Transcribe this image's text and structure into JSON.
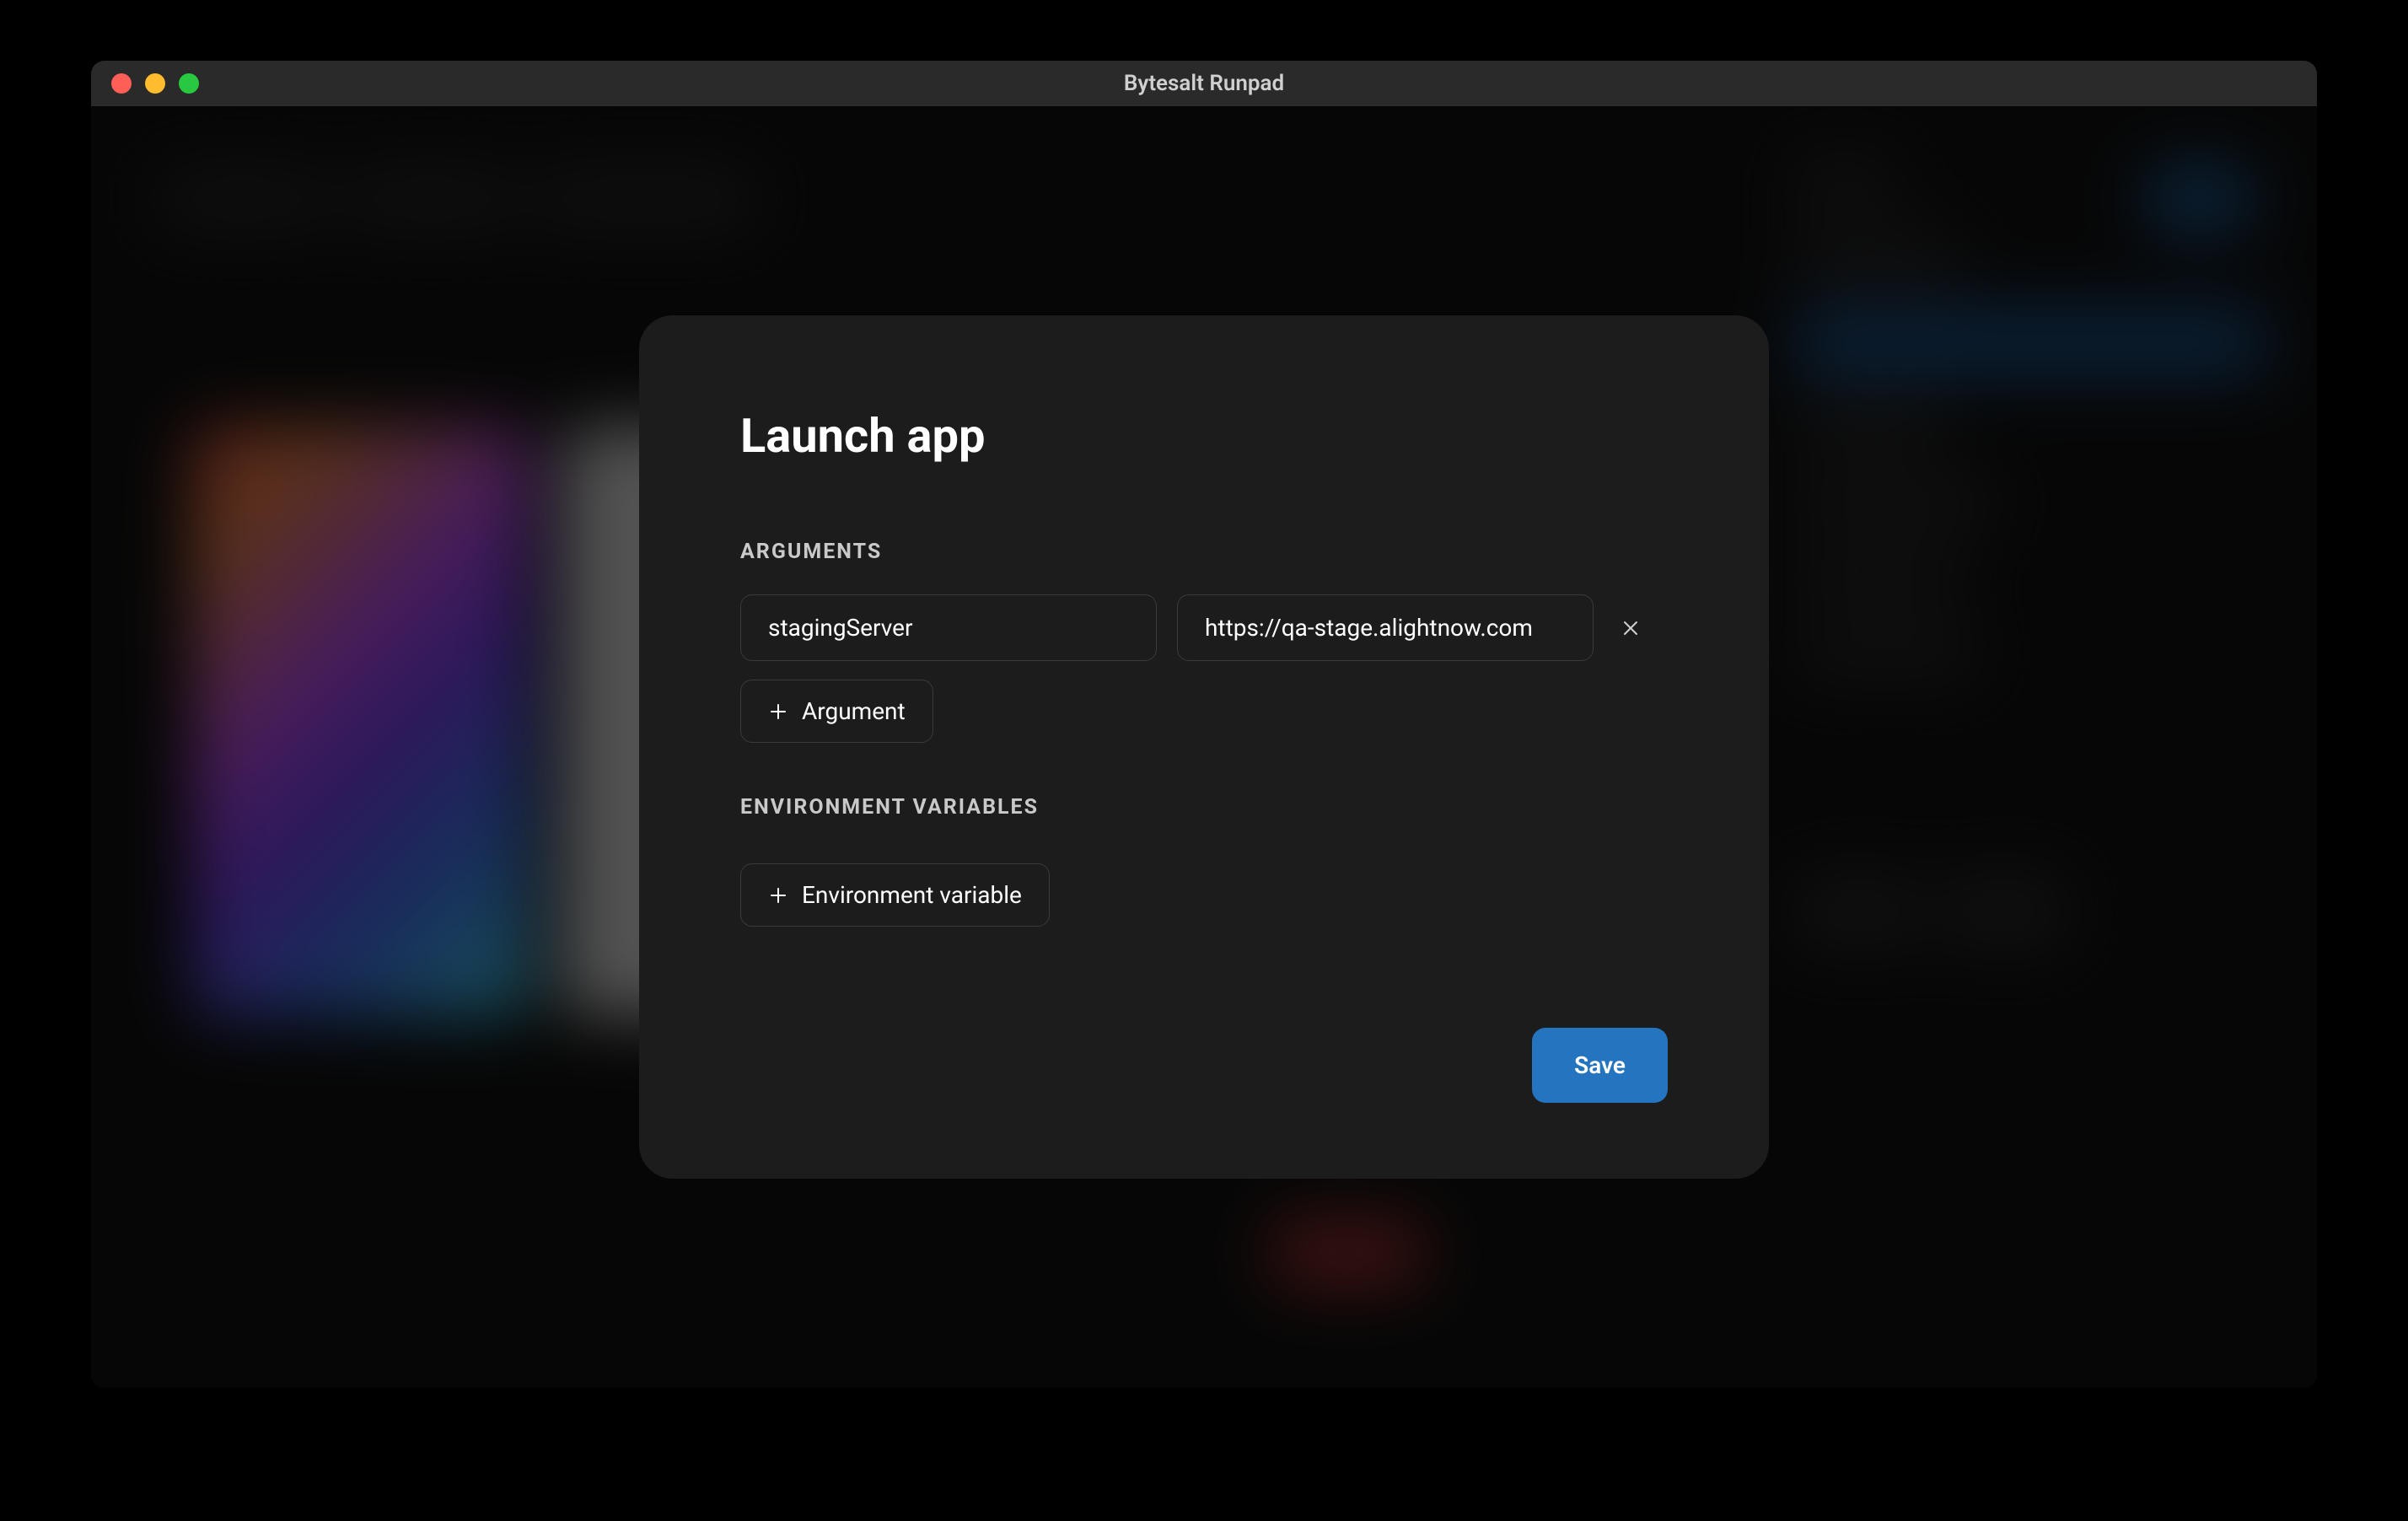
{
  "window": {
    "title": "Bytesalt Runpad"
  },
  "modal": {
    "title": "Launch app",
    "sections": {
      "arguments": {
        "label": "ARGUMENTS",
        "items": [
          {
            "key": "stagingServer",
            "value": "https://qa-stage.alightnow.com"
          }
        ],
        "add_button_label": "Argument"
      },
      "env_vars": {
        "label": "ENVIRONMENT VARIABLES",
        "add_button_label": "Environment variable"
      }
    },
    "save_button_label": "Save"
  },
  "colors": {
    "accent": "#2574c0",
    "modal_bg": "#1c1c1c",
    "window_bg": "#0d0d0d"
  }
}
